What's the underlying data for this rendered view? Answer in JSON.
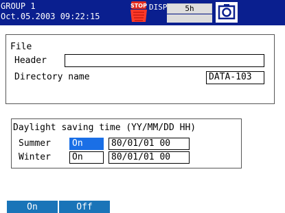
{
  "header": {
    "group": "GROUP 1",
    "datetime": "Oct.05.2003 09:22:15",
    "disp_label": "DISP",
    "div_value": "5h",
    "icons": {
      "stop": "stop-badge-icon",
      "snapshot": "camera-icon"
    },
    "colors": {
      "bar": "#0a1f8f",
      "stop": "#e32b1e"
    }
  },
  "file": {
    "title": "File",
    "header_label": "Header",
    "header_value": "",
    "dir_label": "Directory name",
    "dir_value": "DATA-103"
  },
  "dst": {
    "title": "Daylight saving time (YY/MM/DD HH)",
    "summer_label": "Summer",
    "summer_state": "On",
    "summer_datetime": "80/01/01 00",
    "winter_label": "Winter",
    "winter_state": "On",
    "winter_datetime": "80/01/01 00",
    "selected_color": "#1a6fe6"
  },
  "softkeys": [
    {
      "label": "On"
    },
    {
      "label": "Off"
    }
  ]
}
